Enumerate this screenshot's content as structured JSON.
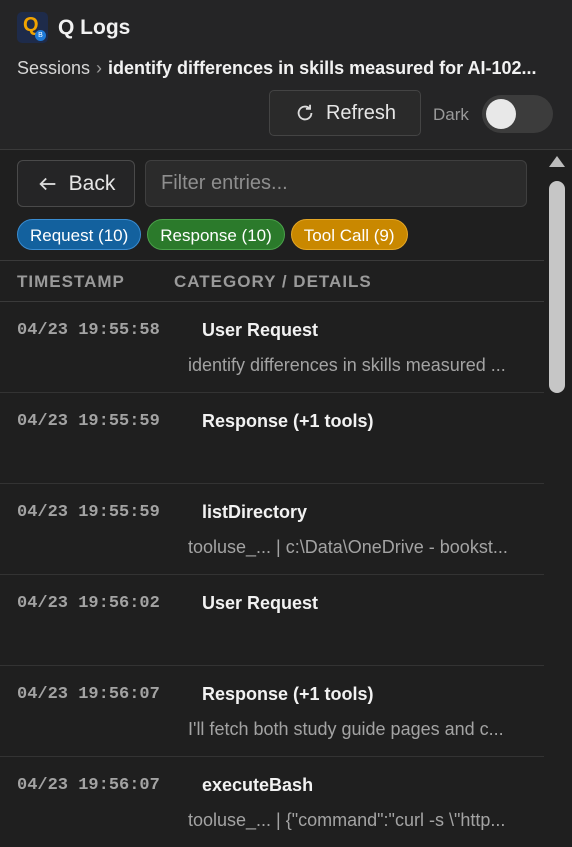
{
  "app": {
    "title": "Q Logs",
    "logo_letter": "Q",
    "logo_badge": "B"
  },
  "breadcrumb": {
    "sessions": "Sessions",
    "separator": "›",
    "current": "identify differences in skills measured for AI-102..."
  },
  "toolbar": {
    "refresh_label": "Refresh",
    "dark_label": "Dark",
    "dark_enabled": false
  },
  "controls": {
    "back_label": "Back",
    "filter_placeholder": "Filter entries..."
  },
  "chips": [
    {
      "label": "Request (10)"
    },
    {
      "label": "Response (10)"
    },
    {
      "label": "Tool Call (9)"
    }
  ],
  "table": {
    "headers": {
      "timestamp": "TIMESTAMP",
      "category": "CATEGORY / DETAILS"
    },
    "rows": [
      {
        "timestamp": "04/23 19:55:58",
        "title": "User Request",
        "detail": "identify differences in skills measured ..."
      },
      {
        "timestamp": "04/23 19:55:59",
        "title": "Response (+1 tools)",
        "detail": ""
      },
      {
        "timestamp": "04/23 19:55:59",
        "title": "listDirectory",
        "detail": "tooluse_... | c:\\Data\\OneDrive - bookst..."
      },
      {
        "timestamp": "04/23 19:56:02",
        "title": "User Request",
        "detail": ""
      },
      {
        "timestamp": "04/23 19:56:07",
        "title": "Response (+1 tools)",
        "detail": "I'll fetch both study guide pages and c..."
      },
      {
        "timestamp": "04/23 19:56:07",
        "title": "executeBash",
        "detail": "tooluse_... | {\"command\":\"curl -s \\\"http..."
      }
    ]
  },
  "colors": {
    "request": "#13619e",
    "response": "#2b7a2b",
    "tool_call": "#c98800"
  },
  "icons": {
    "refresh": "refresh-icon",
    "back": "arrow-left-icon",
    "scroll_up": "chevron-up-icon"
  }
}
